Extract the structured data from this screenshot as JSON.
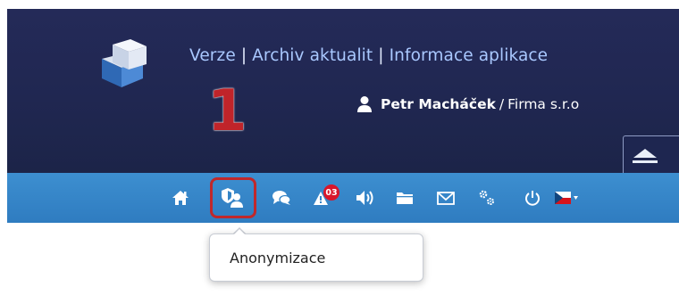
{
  "header": {
    "links": {
      "version": "Verze",
      "archive": "Archiv aktualit",
      "app_info": "Informace aplikace",
      "separator": "|"
    },
    "user": {
      "name": "Petr Macháček",
      "separator": "/",
      "company": "Firma s.r.o"
    }
  },
  "toolbar": {
    "items": [
      {
        "icon": "home-icon"
      },
      {
        "icon": "anonymization-icon"
      },
      {
        "icon": "chat-icon"
      },
      {
        "icon": "alerts-icon",
        "badge": "03"
      },
      {
        "icon": "speaker-icon"
      },
      {
        "icon": "folder-icon"
      },
      {
        "icon": "mail-icon"
      },
      {
        "icon": "settings-icon"
      },
      {
        "icon": "power-icon"
      },
      {
        "icon": "flag-cz-icon"
      }
    ]
  },
  "annotation": {
    "step_number": "1"
  },
  "tooltip": {
    "text": "Anonymizace"
  },
  "colors": {
    "header_bg": "#222955",
    "toolbar_bg": "#3585c6",
    "link": "#a9c8ff",
    "highlight": "#c0282b",
    "badge": "#d9162a"
  }
}
